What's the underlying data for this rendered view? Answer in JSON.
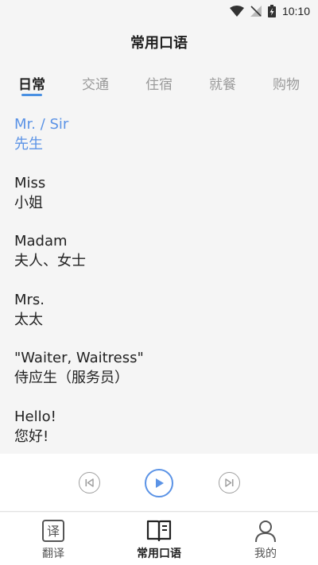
{
  "status": {
    "time": "10:10"
  },
  "header": {
    "title": "常用口语"
  },
  "tabs": [
    {
      "label": "日常",
      "active": true
    },
    {
      "label": "交通",
      "active": false
    },
    {
      "label": "住宿",
      "active": false
    },
    {
      "label": "就餐",
      "active": false
    },
    {
      "label": "购物",
      "active": false
    }
  ],
  "phrases": [
    {
      "en": "Mr. / Sir",
      "zh": "先生"
    },
    {
      "en": "Miss",
      "zh": "小姐"
    },
    {
      "en": "Madam",
      "zh": "夫人、女士"
    },
    {
      "en": "Mrs.",
      "zh": "太太"
    },
    {
      "en": "\"Waiter, Waitress\"",
      "zh": "侍应生（服务员）"
    },
    {
      "en": "Hello!",
      "zh": "您好!"
    }
  ],
  "player": {
    "prev_icon": "skip-previous-icon",
    "play_icon": "play-icon",
    "next_icon": "skip-next-icon"
  },
  "nav": [
    {
      "label": "翻译",
      "icon": "translate-icon"
    },
    {
      "label": "常用口语",
      "icon": "book-icon"
    },
    {
      "label": "我的",
      "icon": "user-icon"
    }
  ],
  "colors": {
    "accent": "#5b93e6",
    "tab_underline": "#4a90e2",
    "background": "#f5f5f5"
  }
}
